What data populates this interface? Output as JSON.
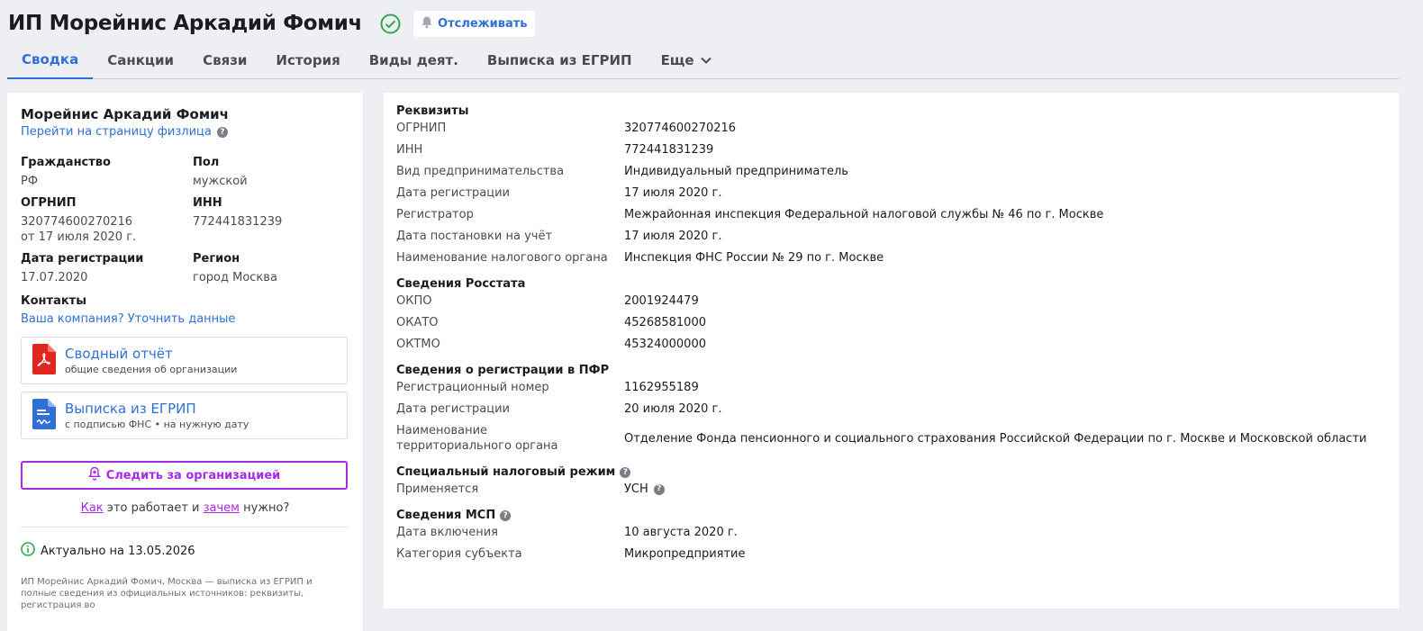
{
  "header": {
    "title": "ИП Морейнис Аркадий Фомич",
    "follow_label": "Отслеживать"
  },
  "tabs": [
    {
      "label": "Сводка",
      "active": true
    },
    {
      "label": "Санкции"
    },
    {
      "label": "Связи"
    },
    {
      "label": "История"
    },
    {
      "label": "Виды деят."
    },
    {
      "label": "Выписка из ЕГРИП"
    },
    {
      "label": "Еще"
    }
  ],
  "left": {
    "name": "Морейнис Аркадий Фомич",
    "person_link": "Перейти на страницу физлица",
    "citizenship_label": "Гражданство",
    "citizenship_value": "РФ",
    "gender_label": "Пол",
    "gender_value": "мужской",
    "ogrnip_label": "ОГРНИП",
    "ogrnip_value": "320774600270216",
    "ogrnip_date": "от 17 июля 2020 г.",
    "inn_label": "ИНН",
    "inn_value": "772441831239",
    "regdate_label": "Дата регистрации",
    "regdate_value": "17.07.2020",
    "region_label": "Регион",
    "region_value": "город Москва",
    "contacts_label": "Контакты",
    "contacts_link": "Ваша компания? Уточнить данные",
    "card1_title": "Сводный отчёт",
    "card1_sub": "общие сведения об организации",
    "card2_title": "Выписка из ЕГРИП",
    "card2_sub": "с подписью ФНС • на нужную дату",
    "watch_label": "Следить за организацией",
    "how_link1": "Как",
    "how_text1": " это работает и ",
    "how_link2": "зачем",
    "how_text2": " нужно?",
    "actual": "Актуально на 13.05.2026",
    "footnote": "ИП Морейнис Аркадий Фомич, Москва — выписка из ЕГРИП и полные сведения из официальных источников: реквизиты, регистрация во"
  },
  "right": {
    "sections": [
      {
        "title": "Реквизиты",
        "rows": [
          {
            "k": "ОГРНИП",
            "v": "320774600270216"
          },
          {
            "k": "ИНН",
            "v": "772441831239"
          },
          {
            "k": "Вид предпринимательства",
            "v": "Индивидуальный предприниматель"
          },
          {
            "k": "Дата регистрации",
            "v": "17 июля 2020 г."
          },
          {
            "k": "Регистратор",
            "v": "Межрайонная инспекция Федеральной налоговой службы № 46 по г. Москве"
          },
          {
            "k": "Дата постановки на учёт",
            "v": "17 июля 2020 г."
          },
          {
            "k": "Наименование налогового органа",
            "v": "Инспекция ФНС России № 29 по г. Москве"
          }
        ]
      },
      {
        "title": "Сведения Росстата",
        "rows": [
          {
            "k": "ОКПО",
            "v": "2001924479"
          },
          {
            "k": "ОКАТО",
            "v": "45268581000"
          },
          {
            "k": "ОКТМО",
            "v": "45324000000"
          }
        ]
      },
      {
        "title": "Сведения о регистрации в ПФР",
        "rows": [
          {
            "k": "Регистрационный номер",
            "v": "1162955189"
          },
          {
            "k": "Дата регистрации",
            "v": "20 июля 2020 г."
          },
          {
            "k": "Наименование территориального органа",
            "v": "Отделение Фонда пенсионного и социального страхования Российской Федерации по г. Москве и Московской области"
          }
        ]
      },
      {
        "title": "Специальный налоговый режим",
        "help": true,
        "rows": [
          {
            "k": "Применяется",
            "v": "УСН",
            "help": true
          }
        ]
      },
      {
        "title": "Сведения МСП",
        "help": true,
        "rows": [
          {
            "k": "Дата включения",
            "v": "10 августа 2020 г."
          },
          {
            "k": "Категория субъекта",
            "v": "Микропредприятие"
          }
        ]
      }
    ]
  }
}
